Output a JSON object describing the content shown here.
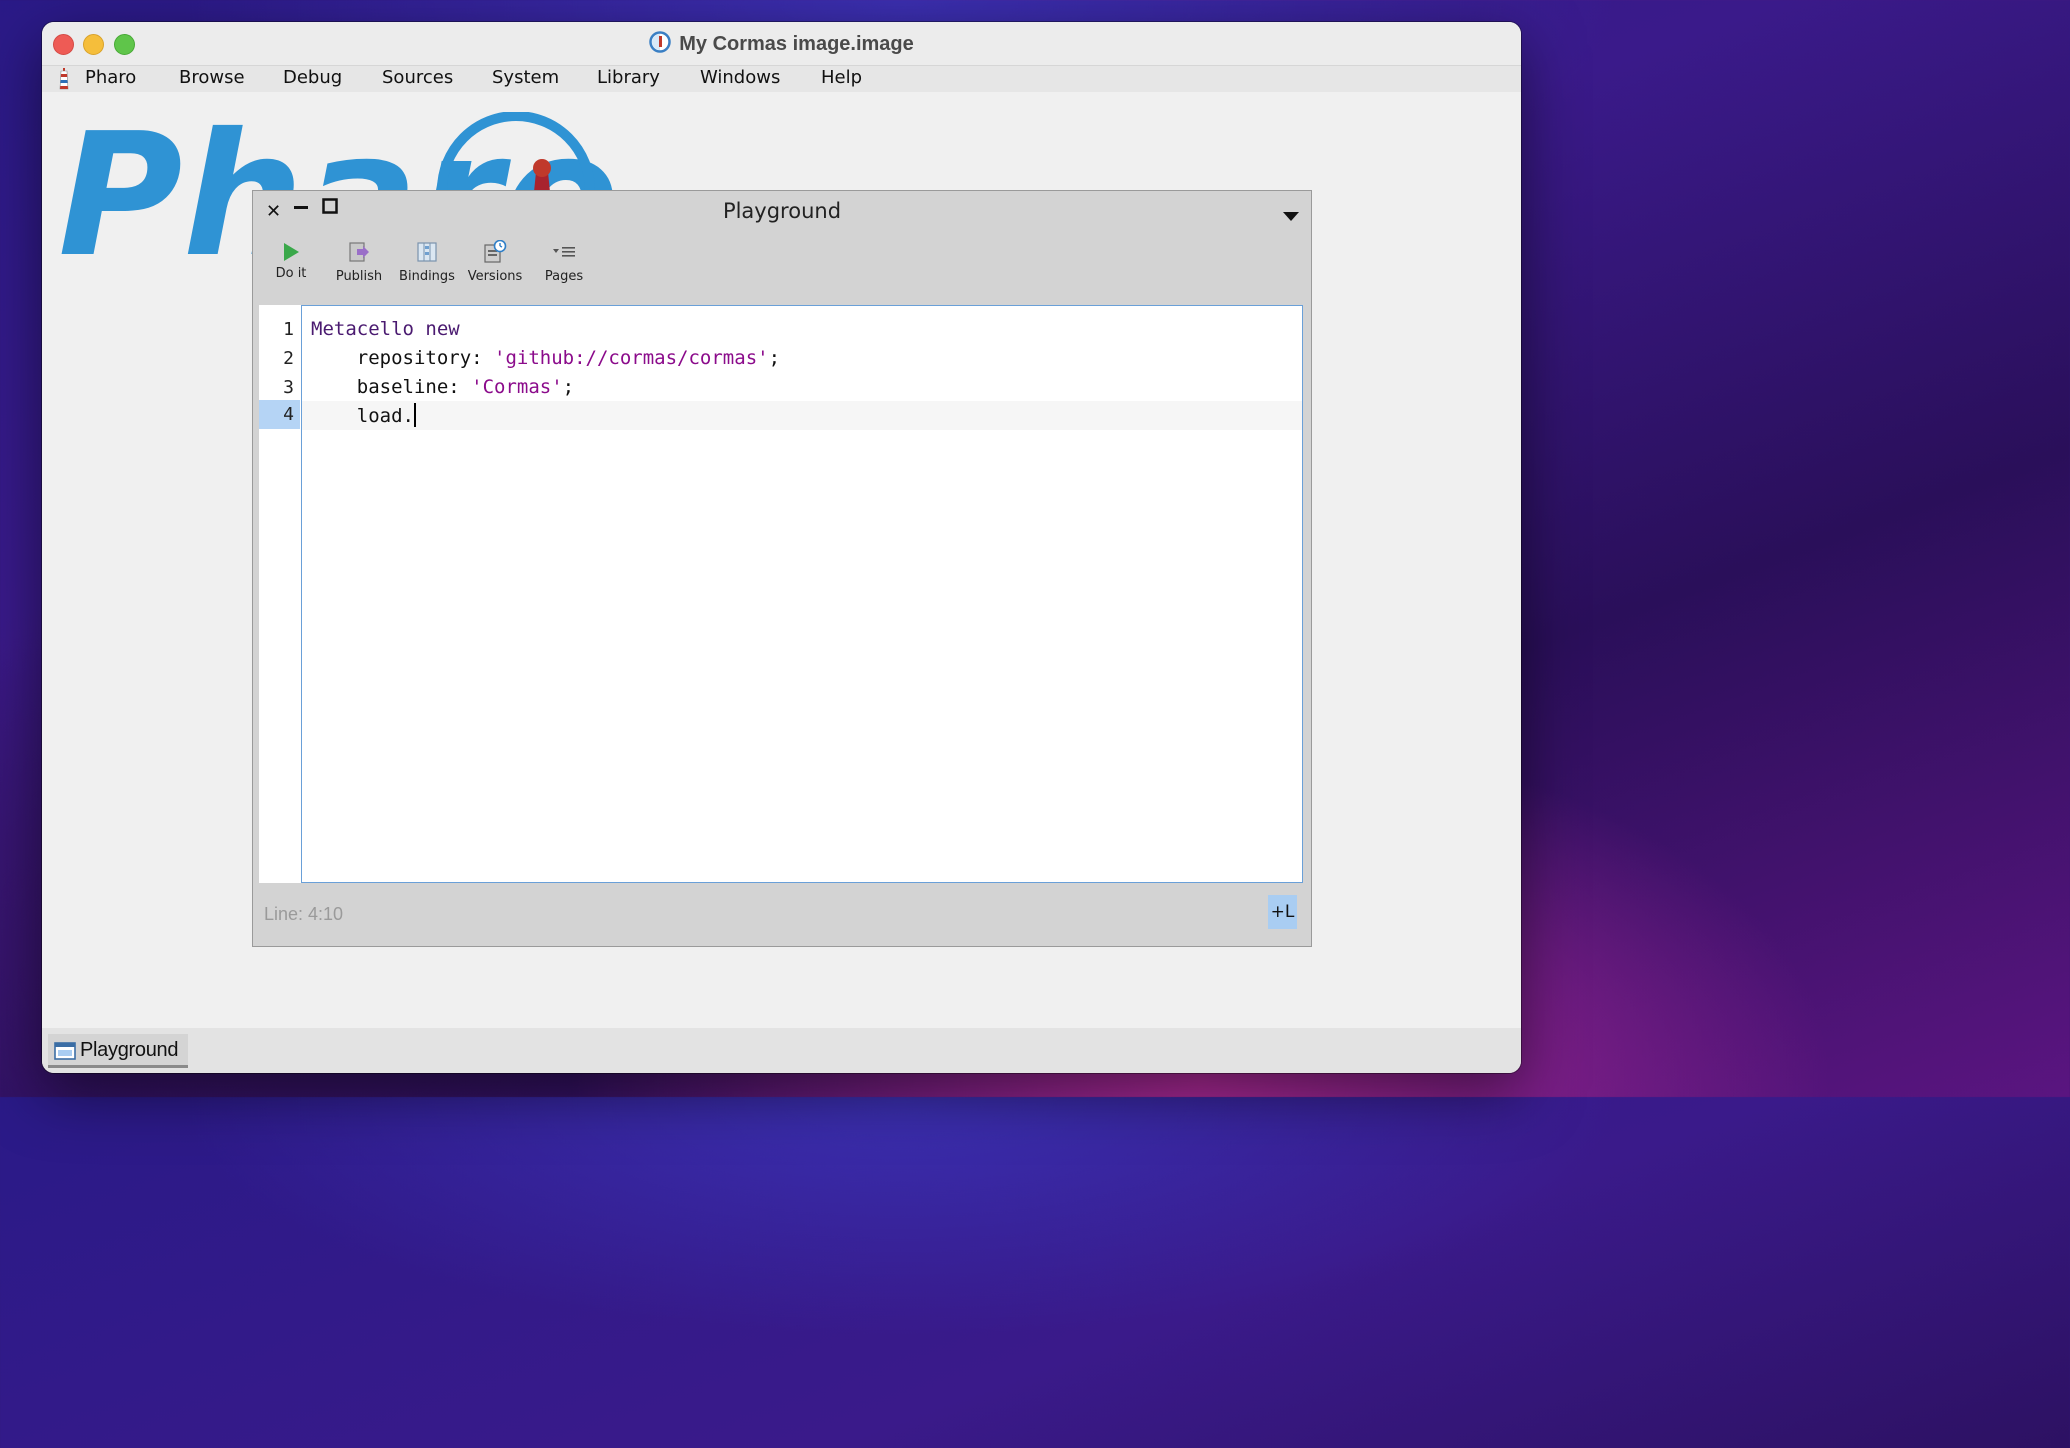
{
  "window": {
    "title": "My Cormas image.image"
  },
  "menubar": {
    "items": [
      "Pharo",
      "Browse",
      "Debug",
      "Sources",
      "System",
      "Library",
      "Windows",
      "Help"
    ]
  },
  "background_logo": {
    "text": "Pharo"
  },
  "playground": {
    "title": "Playground",
    "toolbar": [
      {
        "label": "Do it",
        "icon": "play-icon"
      },
      {
        "label": "Publish",
        "icon": "publish-icon"
      },
      {
        "label": "Bindings",
        "icon": "bindings-icon"
      },
      {
        "label": "Versions",
        "icon": "versions-icon"
      },
      {
        "label": "Pages",
        "icon": "pages-icon"
      }
    ],
    "line_numbers": [
      "1",
      "2",
      "3",
      "4"
    ],
    "active_line": 4,
    "code": [
      {
        "a": "Metacello new",
        "b": "",
        "c": ""
      },
      {
        "a": "    repository: ",
        "b": "'github://cormas/cormas'",
        "c": ";"
      },
      {
        "a": "    baseline: ",
        "b": "'Cormas'",
        "c": ";"
      },
      {
        "a": "    load.",
        "b": "",
        "c": ""
      }
    ],
    "status": "Line: 4:10",
    "line_toggle": "+L"
  },
  "taskbar": {
    "items": [
      {
        "label": "Playground"
      }
    ]
  },
  "colors": {
    "editor_border": "#6aa0d8",
    "active_line_number": "#b5d4f5",
    "string_literal": "#8b0b8b",
    "keyword": "#4a1a70",
    "pharo_blue": "#2f93d4"
  }
}
